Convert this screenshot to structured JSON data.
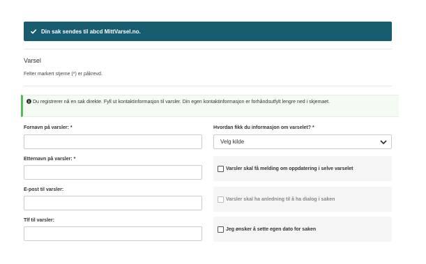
{
  "banner": {
    "icon": "check-icon",
    "text": "Din sak sendes til abcd MittVarsel.no."
  },
  "section": {
    "title": "Varsel",
    "required_note": "Felter markert stjerne (*) er påkrevd."
  },
  "info": {
    "icon": "info-circle-icon",
    "text": "Du registrerer nå en sak direkte. Fyll ut kontaktinformasjon til varsler. Din egen kontaktinformasjon er forhåndsutfylt lengre ned i skjemaet."
  },
  "form": {
    "first_name": {
      "label": "Fornavn på varsler: *",
      "value": ""
    },
    "last_name": {
      "label": "Etternavn på varsler: *",
      "value": ""
    },
    "email": {
      "label": "E-post til varsler:",
      "value": ""
    },
    "phone": {
      "label": "Tlf til varsler:",
      "value": ""
    },
    "source": {
      "label": "Hvordan fikk du informasjon om varselet? *",
      "selected": "Velg kilde",
      "icon": "chevron-down-icon"
    },
    "checkboxes": [
      {
        "label": "Varsler skal få melding om oppdatering i selve varselet",
        "checked": false,
        "disabled": false
      },
      {
        "label": "Varsler skal ha anledning til å ha dialog i saken",
        "checked": false,
        "disabled": true
      },
      {
        "label": "Jeg ønsker å sette egen dato for saken",
        "checked": false,
        "disabled": false
      }
    ]
  },
  "colors": {
    "banner_bg": "#175d6f",
    "info_border": "#5cb85c",
    "info_bg": "#f3fbf3"
  }
}
